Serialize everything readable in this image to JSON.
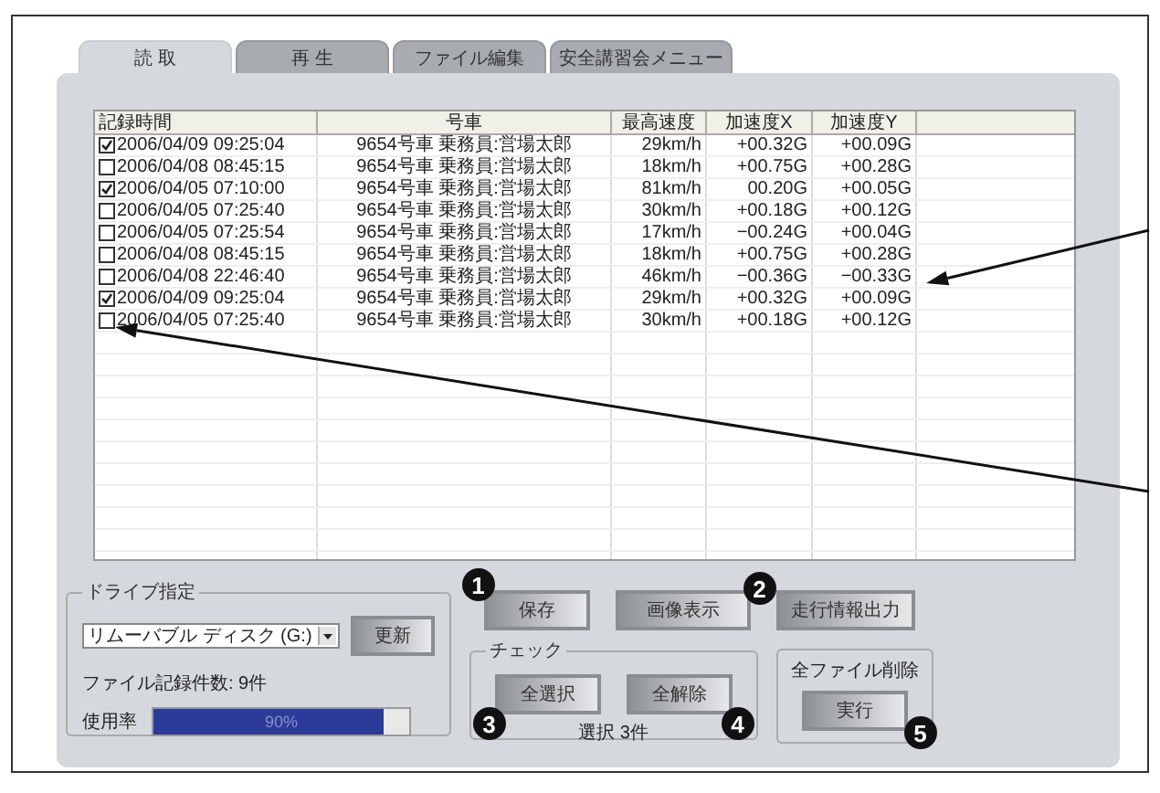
{
  "tabs": [
    {
      "label": "読 取",
      "selected": true
    },
    {
      "label": "再 生",
      "selected": false
    },
    {
      "label": "ファイル編集",
      "selected": false
    },
    {
      "label": "安全講習会メニュー",
      "selected": false
    }
  ],
  "table": {
    "columns": [
      "記録時間",
      "号車",
      "最高速度",
      "加速度X",
      "加速度Y"
    ],
    "rows": [
      {
        "checked": true,
        "cells": [
          "2006/04/09 09:25:04",
          "9654号車 乗務員:営場太郎",
          "29km/h",
          "+00.32G",
          "+00.09G"
        ]
      },
      {
        "checked": false,
        "cells": [
          "2006/04/08 08:45:15",
          "9654号車 乗務員:営場太郎",
          "18km/h",
          "+00.75G",
          "+00.28G"
        ]
      },
      {
        "checked": true,
        "cells": [
          "2006/04/05 07:10:00",
          "9654号車 乗務員:営場太郎",
          "81km/h",
          "00.20G",
          "+00.05G"
        ]
      },
      {
        "checked": false,
        "cells": [
          "2006/04/05 07:25:40",
          "9654号車 乗務員:営場太郎",
          "30km/h",
          "+00.18G",
          "+00.12G"
        ]
      },
      {
        "checked": false,
        "cells": [
          "2006/04/05 07:25:54",
          "9654号車 乗務員:営場太郎",
          "17km/h",
          "−00.24G",
          "+00.04G"
        ]
      },
      {
        "checked": false,
        "cells": [
          "2006/04/08 08:45:15",
          "9654号車 乗務員:営場太郎",
          "18km/h",
          "+00.75G",
          "+00.28G"
        ]
      },
      {
        "checked": false,
        "cells": [
          "2006/04/08 22:46:40",
          "9654号車 乗務員:営場太郎",
          "46km/h",
          "−00.36G",
          "−00.33G"
        ]
      },
      {
        "checked": true,
        "cells": [
          "2006/04/09 09:25:04",
          "9654号車 乗務員:営場太郎",
          "29km/h",
          "+00.32G",
          "+00.09G"
        ]
      },
      {
        "checked": false,
        "cells": [
          "2006/04/05 07:25:40",
          "9654号車 乗務員:営場太郎",
          "30km/h",
          "+00.18G",
          "+00.12G"
        ]
      }
    ]
  },
  "drive_group": {
    "label": "ドライブ指定",
    "dropdown": {
      "value": "リムーバブル ディスク (G:)"
    },
    "refresh_button": "更新",
    "file_count": "ファイル記録件数: 9件",
    "usage": {
      "label": "使用率",
      "level": 0.9,
      "reading": "90%"
    }
  },
  "action_buttons": [
    {
      "label": "保存",
      "badge": "1"
    },
    {
      "label": "画像表示",
      "badge": "2"
    },
    {
      "label": "走行情報出力"
    }
  ],
  "check_group": {
    "label": "チェック",
    "buttons": [
      {
        "label": "全選択",
        "badge": "3"
      },
      {
        "label": "全解除",
        "badge": "4"
      }
    ],
    "selected_count": "選択 3件"
  },
  "delete_group": {
    "label": "全ファイル削除",
    "button": {
      "label": "実行",
      "badge": "5"
    }
  }
}
